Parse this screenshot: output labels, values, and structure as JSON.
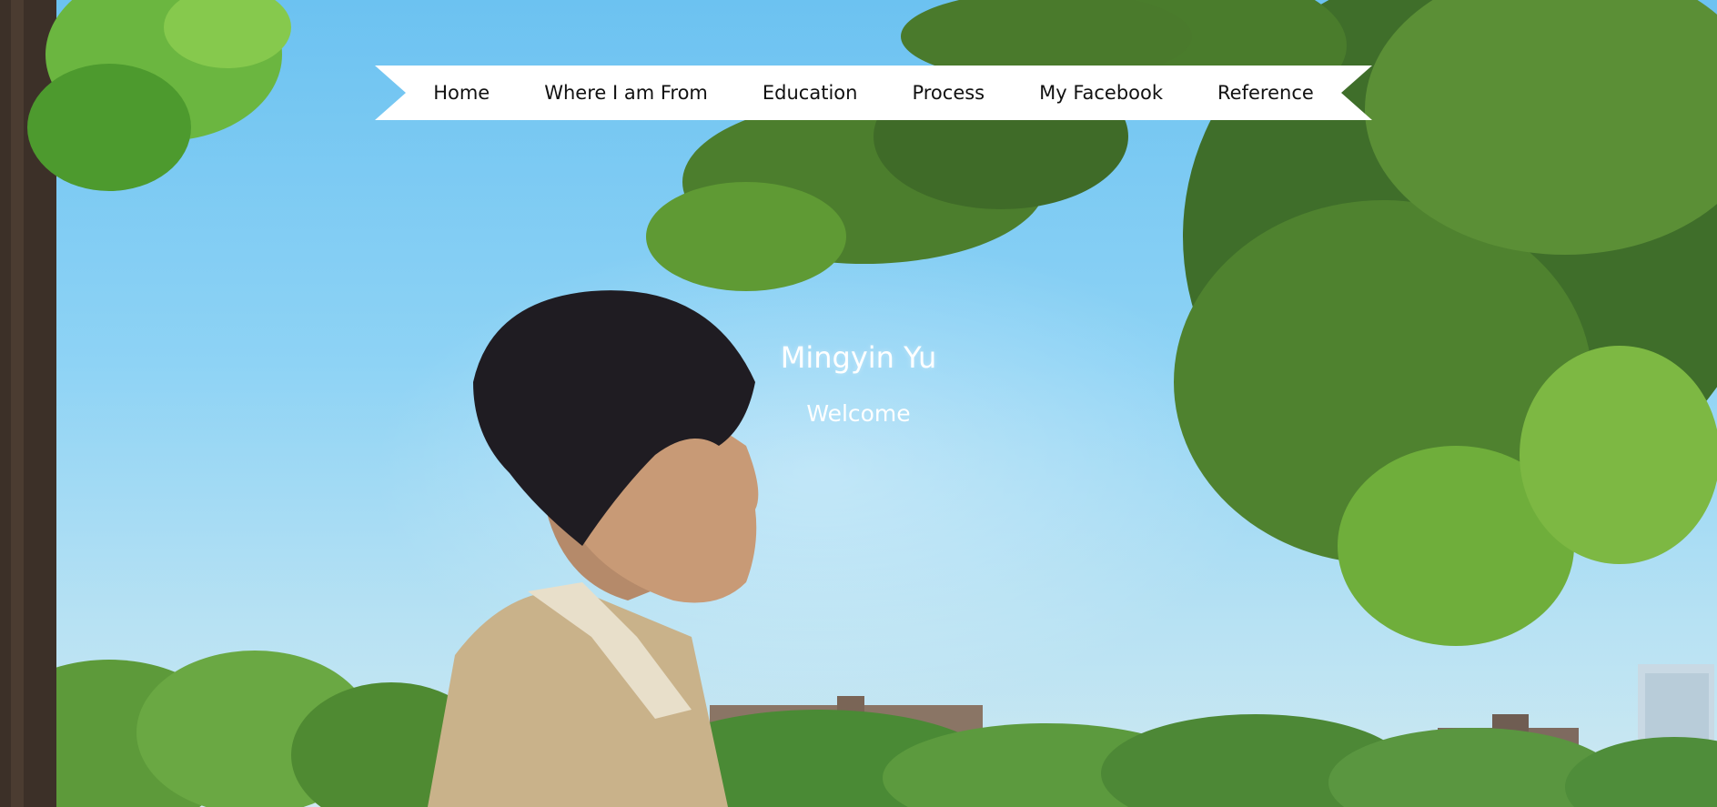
{
  "nav": {
    "items": [
      {
        "label": "Home"
      },
      {
        "label": "Where I am From"
      },
      {
        "label": "Education"
      },
      {
        "label": "Process"
      },
      {
        "label": "My Facebook"
      },
      {
        "label": "Reference"
      }
    ]
  },
  "hero": {
    "title": "Mingyin Yu",
    "subtitle": "Welcome"
  },
  "colors": {
    "nav_background": "#ffffff",
    "nav_text": "#111111",
    "hero_text": "#ffffff",
    "sky": "#8ed3f5"
  },
  "background_image": "photo-of-person-in-profile-under-trees-by-river"
}
